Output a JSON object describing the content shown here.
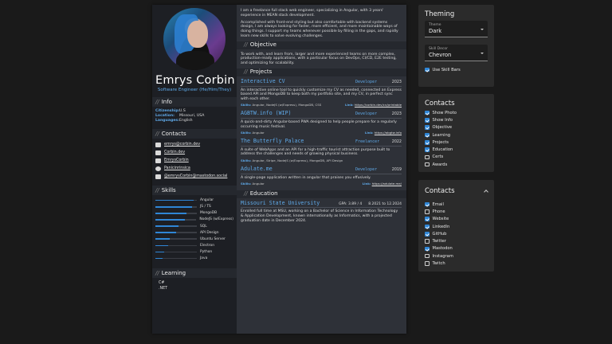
{
  "cv": {
    "name": "Emrys Corbin",
    "role": "Software Engineer (He/Him/They)",
    "info": {
      "heading": "Info",
      "rows": [
        {
          "k": "Citizenship:",
          "v": "U.S"
        },
        {
          "k": "Location:",
          "v": "Missouri, USA"
        },
        {
          "k": "Languages:",
          "v": "English"
        }
      ]
    },
    "contacts": {
      "heading": "Contacts",
      "items": [
        {
          "icon": "mail-icon",
          "text": "emrys@corbin.dev"
        },
        {
          "icon": "website-icon",
          "text": "Corbin.dev"
        },
        {
          "icon": "linkedin-icon",
          "text": "EmrysCorbin"
        },
        {
          "icon": "github-icon",
          "text": "Panicinrinsica"
        },
        {
          "icon": "mastodon-icon",
          "text": "@emrysCorbin@mastodon.social"
        }
      ]
    },
    "skills": {
      "heading": "Skills",
      "items": [
        {
          "label": "Angular",
          "level": 0.92
        },
        {
          "label": "JS / TS",
          "level": 0.88
        },
        {
          "label": "MongoDB",
          "level": 0.75
        },
        {
          "label": "NodeJS (w/Express)",
          "level": 0.72
        },
        {
          "label": "SQL",
          "level": 0.55
        },
        {
          "label": "API Design",
          "level": 0.5
        },
        {
          "label": "Ubuntu Server",
          "level": 0.35
        },
        {
          "label": "Electron",
          "level": 0.3
        },
        {
          "label": "Python",
          "level": 0.22
        },
        {
          "label": "Java",
          "level": 0.18
        }
      ]
    },
    "learning": {
      "heading": "Learning",
      "items": [
        "C#",
        ".NET"
      ]
    },
    "intro": [
      "I am a freelance full stack web engineer, specializing in Angular, with 3 years' experience in MEAN stack development.",
      "Accomplished with front-end styling but also comfortable with backend systems design, I am always looking for faster, more efficient, and more maintainable ways of doing things. I support my teams whenever possible by filling in the gaps, and rapidly learn new skills to solve evolving challenges."
    ],
    "objective": {
      "heading": "Objective",
      "text": "To work with, and learn from, larger and more experienced teams on more complex, production-ready applications, with a particular focus on DevOps, CI/CD, E2E testing, and optimizing for scalability."
    },
    "projects": {
      "heading": "Projects",
      "skills_label": "Skills:",
      "link_label": "Link:",
      "items": [
        {
          "title": "Interactive CV",
          "role": "Developer",
          "year": "2023",
          "desc": "An interactive online tool to quickly customize my CV as needed, connected an Express based API and MongoDB to keep both my portfolio site, and my CV, in perfect sync with each other.",
          "skills": "Angular, NodeJS (w/Express), MongoDB, CSS",
          "link": "https://corbin.dev/cv/printable"
        },
        {
          "title": "AGBTW.info (WIP)",
          "role": "Developer",
          "year": "2023",
          "desc": "A quick-and-dirty Angular-based PWA designed to help people prepare for a regularly occurring music festival.",
          "skills": "Angular",
          "link": "https://abgtw.info"
        },
        {
          "title": "The Butterfly Palace",
          "role": "Freelancer",
          "year": "2022",
          "desc": "A suite of WebApps and an API for a high-traffic tourist attraction purpose built to address the challenges and needs of growing physical business.",
          "skills": "Angular, Stripe, NodeJS (w/Express), MongoDB, API Design",
          "link": ""
        },
        {
          "title": "Adulate.me",
          "role": "Developer",
          "year": "2019",
          "desc": "A single-page application written in angular that praises you effusively.",
          "skills": "Angular",
          "link": "https://adulate.me/"
        }
      ]
    },
    "education": {
      "heading": "Education",
      "school": "Missouri State University",
      "gpa": "GPA: 3.89 / 4",
      "dates": "8.2021 to 12.2024",
      "text": "Enrolled full time at MSU, working on a Bachelor of Science in Information Technology & Application Development, known internationally as Informatics, with a projected graduation date in December 2024."
    }
  },
  "theming": {
    "title": "Theming",
    "theme": {
      "label": "Theme",
      "value": "Dark"
    },
    "skill_decor": {
      "label": "Skill Decor",
      "value": "Chevron"
    },
    "use_skill_bars": {
      "label": "Use Skill Bars",
      "checked": true
    }
  },
  "contacts_panel": {
    "title": "Contacts",
    "options": [
      {
        "label": "Show Photo",
        "checked": true
      },
      {
        "label": "Show Info",
        "checked": true
      },
      {
        "label": "Objective",
        "checked": true
      },
      {
        "label": "Learning",
        "checked": true
      },
      {
        "label": "Projects",
        "checked": true
      },
      {
        "label": "Education",
        "checked": true
      },
      {
        "label": "Certs",
        "checked": false
      },
      {
        "label": "Awards",
        "checked": false
      }
    ]
  },
  "contacts_panel2": {
    "title": "Contacts",
    "options": [
      {
        "label": "Email",
        "checked": true
      },
      {
        "label": "Phone",
        "checked": false
      },
      {
        "label": "Website",
        "checked": true
      },
      {
        "label": "LinkedIn",
        "checked": true
      },
      {
        "label": "GitHub",
        "checked": true
      },
      {
        "label": "Twitter",
        "checked": false
      },
      {
        "label": "Mastodon",
        "checked": true
      },
      {
        "label": "Instagram",
        "checked": false
      },
      {
        "label": "Twitch",
        "checked": false
      }
    ]
  },
  "colors": {
    "accent": "#2f86d6",
    "link_blue": "#5fa9e8",
    "page_bg": "#1a1a1a",
    "panel_bg": "#2b2b2b"
  }
}
